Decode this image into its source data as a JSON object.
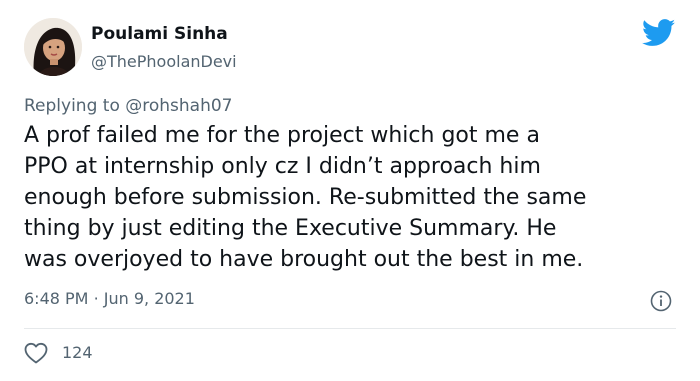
{
  "author": {
    "display_name": "Poulami Sinha",
    "handle": "@ThePhoolanDevi",
    "avatar": "profile-photo-icon"
  },
  "brand": {
    "logo": "twitter-bird-icon",
    "color": "#1d9bf0"
  },
  "reply": {
    "prefix": "Replying to",
    "mention": "@rohshah07"
  },
  "tweet": {
    "lines": [
      "A prof failed me for the project which got me a",
      "PPO at internship only cz I didn’t approach him",
      "enough before submission. Re-submitted the same",
      "thing by just editing the Executive Summary. He",
      "was overjoyed to have brought out the best in me."
    ],
    "time": "6:48 PM",
    "separator": "·",
    "date": "Jun 9, 2021"
  },
  "actions": {
    "info_icon": "info-icon",
    "like_icon": "heart-icon",
    "like_count": "124"
  },
  "colors": {
    "text": "#0f1419",
    "secondary": "#536471",
    "divider": "#e6e9eb"
  }
}
